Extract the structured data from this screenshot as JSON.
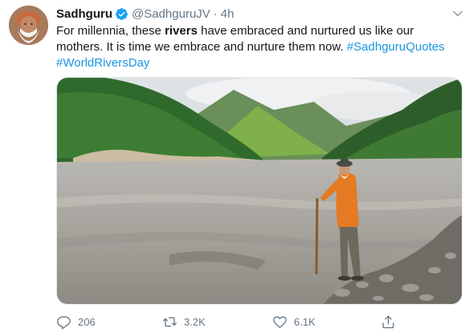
{
  "tweet": {
    "display_name": "Sadhguru",
    "handle": "@SadhguruJV",
    "separator": "·",
    "time": "4h",
    "text_before": "For millennia, these ",
    "text_bold": "rivers",
    "text_after": " have embraced and nurtured us like our mothers. It is time we embrace and nurture them now. ",
    "hashtag_1": "#SadhguruQuotes",
    "hashtag_2": "#WorldRiversDay"
  },
  "actions": {
    "replies": "206",
    "retweets": "3.2K",
    "likes": "6.1K"
  },
  "icons": {
    "verified": "verified-badge-icon",
    "caret": "chevron-down-icon",
    "reply": "reply-icon",
    "retweet": "retweet-icon",
    "like": "heart-icon",
    "share": "share-icon"
  },
  "colors": {
    "link": "#1b95e0",
    "secondary_text": "#657786",
    "verified": "#1da1f2"
  }
}
